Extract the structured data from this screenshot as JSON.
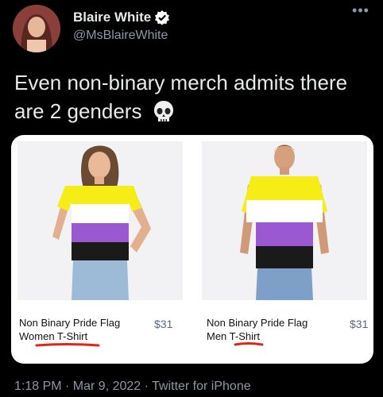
{
  "author": {
    "name": "Blaire White",
    "handle": "@MsBlaireWhite"
  },
  "tweet": {
    "text": "Even non-binary merch admits there are 2 genders",
    "emoji": "skull-icon"
  },
  "products": [
    {
      "name": "Non Binary Pride Flag Women T-Shirt",
      "price": "$31"
    },
    {
      "name": "Non Binary Pride Flag Men T-Shirt",
      "price": "$31"
    }
  ],
  "meta": {
    "line": "1:18 PM · Mar 9, 2022 · Twitter for iPhone"
  },
  "colors": {
    "background": "#000000",
    "flag_yellow": "#f6ec16",
    "flag_white": "#ffffff",
    "flag_purple": "#9a59d1",
    "flag_black": "#1a1a1a",
    "underline_red": "#e0251b",
    "verified_badge": "#ffffff",
    "price_text": "#5b5f87"
  }
}
